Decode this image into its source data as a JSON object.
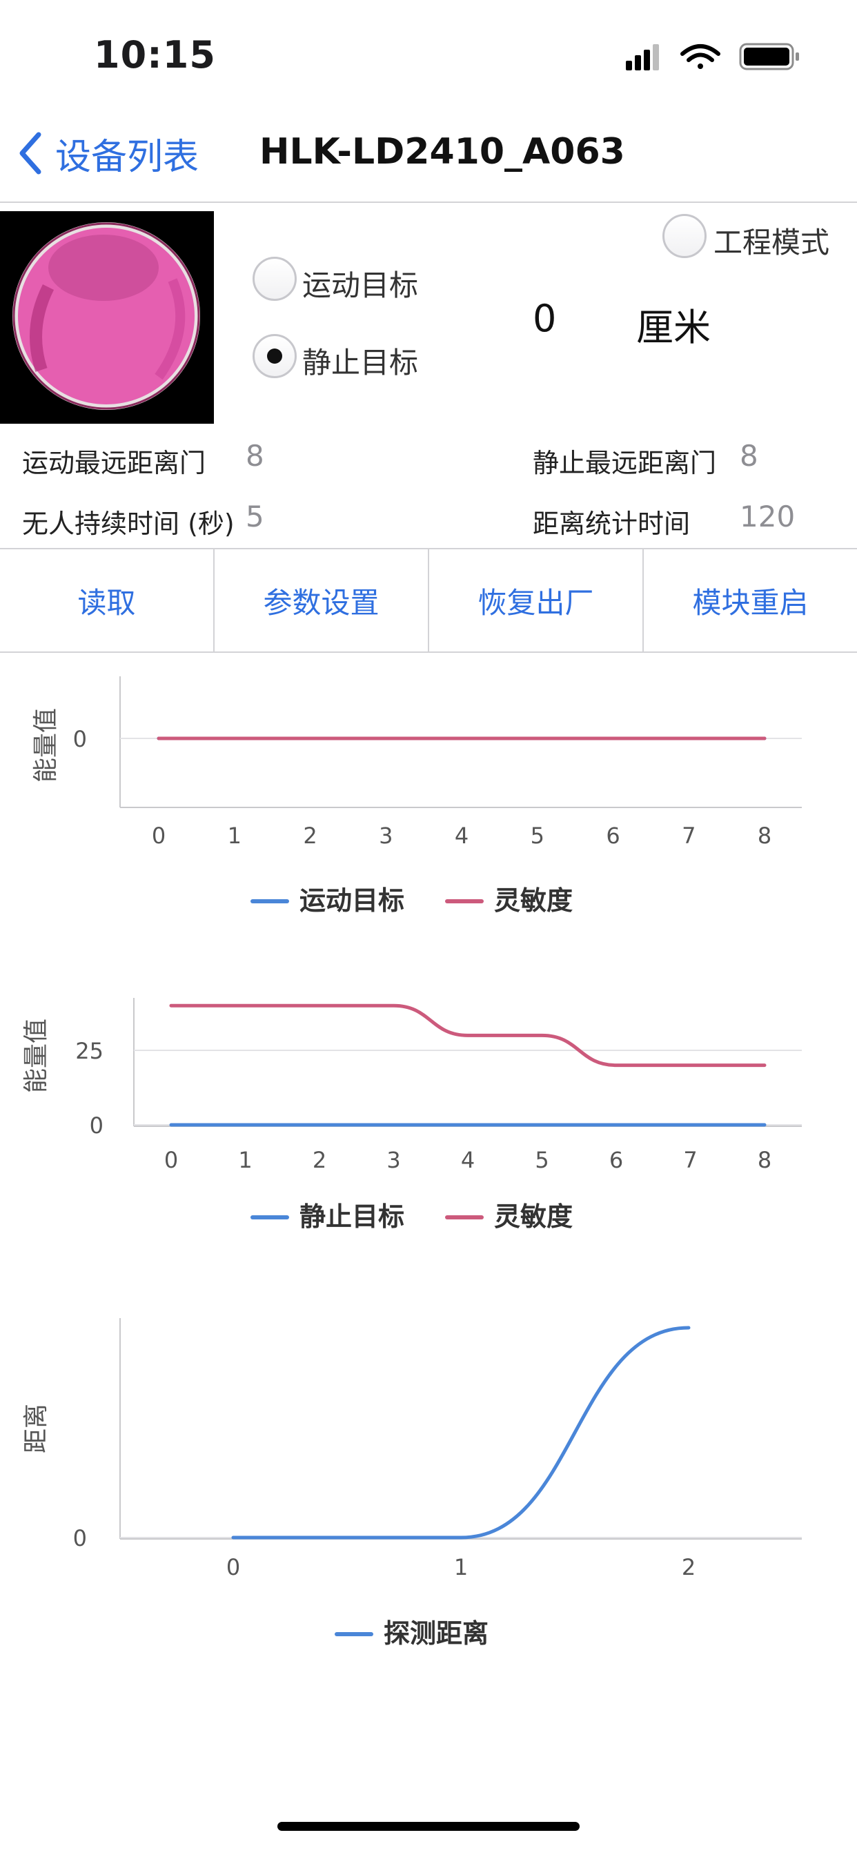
{
  "status_bar": {
    "time": "10:15"
  },
  "nav": {
    "back_label": "设备列表",
    "title": "HLK-LD2410_A063"
  },
  "device": {
    "engineering_mode_label": "工程模式",
    "moving_target_label": "运动目标",
    "static_target_label": "静止目标",
    "selected_target": "静止目标",
    "distance_value": "0",
    "distance_unit": "厘米"
  },
  "params": {
    "motion_max_gate_label": "运动最远距离门",
    "motion_max_gate_value": "8",
    "static_max_gate_label": "静止最远距离门",
    "static_max_gate_value": "8",
    "no_one_duration_label": "无人持续时间 (秒)",
    "no_one_duration_value": "5",
    "distance_stat_time_label": "距离统计时间",
    "distance_stat_time_value": "120"
  },
  "actions": [
    "读取",
    "参数设置",
    "恢复出厂",
    "模块重启"
  ],
  "colors": {
    "accent": "#2f6fe0",
    "series_blue": "#4a86d8",
    "series_red": "#cc5a7c"
  },
  "chart_data": [
    {
      "type": "line",
      "x": [
        0,
        1,
        2,
        3,
        4,
        5,
        6,
        7,
        8
      ],
      "ylabel": "能量值",
      "y_ticks": [
        "0"
      ],
      "series": [
        {
          "name": "运动目标",
          "color": "#4a86d8",
          "values": [
            0,
            0,
            0,
            0,
            0,
            0,
            0,
            0,
            0
          ]
        },
        {
          "name": "灵敏度",
          "color": "#cc5a7c",
          "values": [
            0,
            0,
            0,
            0,
            0,
            0,
            0,
            0,
            0
          ]
        }
      ]
    },
    {
      "type": "line",
      "x": [
        0,
        1,
        2,
        3,
        4,
        5,
        6,
        7,
        8
      ],
      "ylabel": "能量值",
      "y_ticks": [
        "0",
        "25"
      ],
      "ylim": [
        0,
        50
      ],
      "series": [
        {
          "name": "静止目标",
          "color": "#4a86d8",
          "values": [
            0,
            0,
            0,
            0,
            0,
            0,
            0,
            0,
            0
          ]
        },
        {
          "name": "灵敏度",
          "color": "#cc5a7c",
          "values": [
            40,
            40,
            40,
            40,
            30,
            30,
            20,
            20,
            20
          ]
        }
      ]
    },
    {
      "type": "line",
      "x": [
        0,
        1,
        2
      ],
      "ylabel": "距离",
      "y_ticks": [
        "0"
      ],
      "series": [
        {
          "name": "探测距离",
          "color": "#4a86d8",
          "values": [
            0,
            0,
            100
          ]
        }
      ]
    }
  ]
}
